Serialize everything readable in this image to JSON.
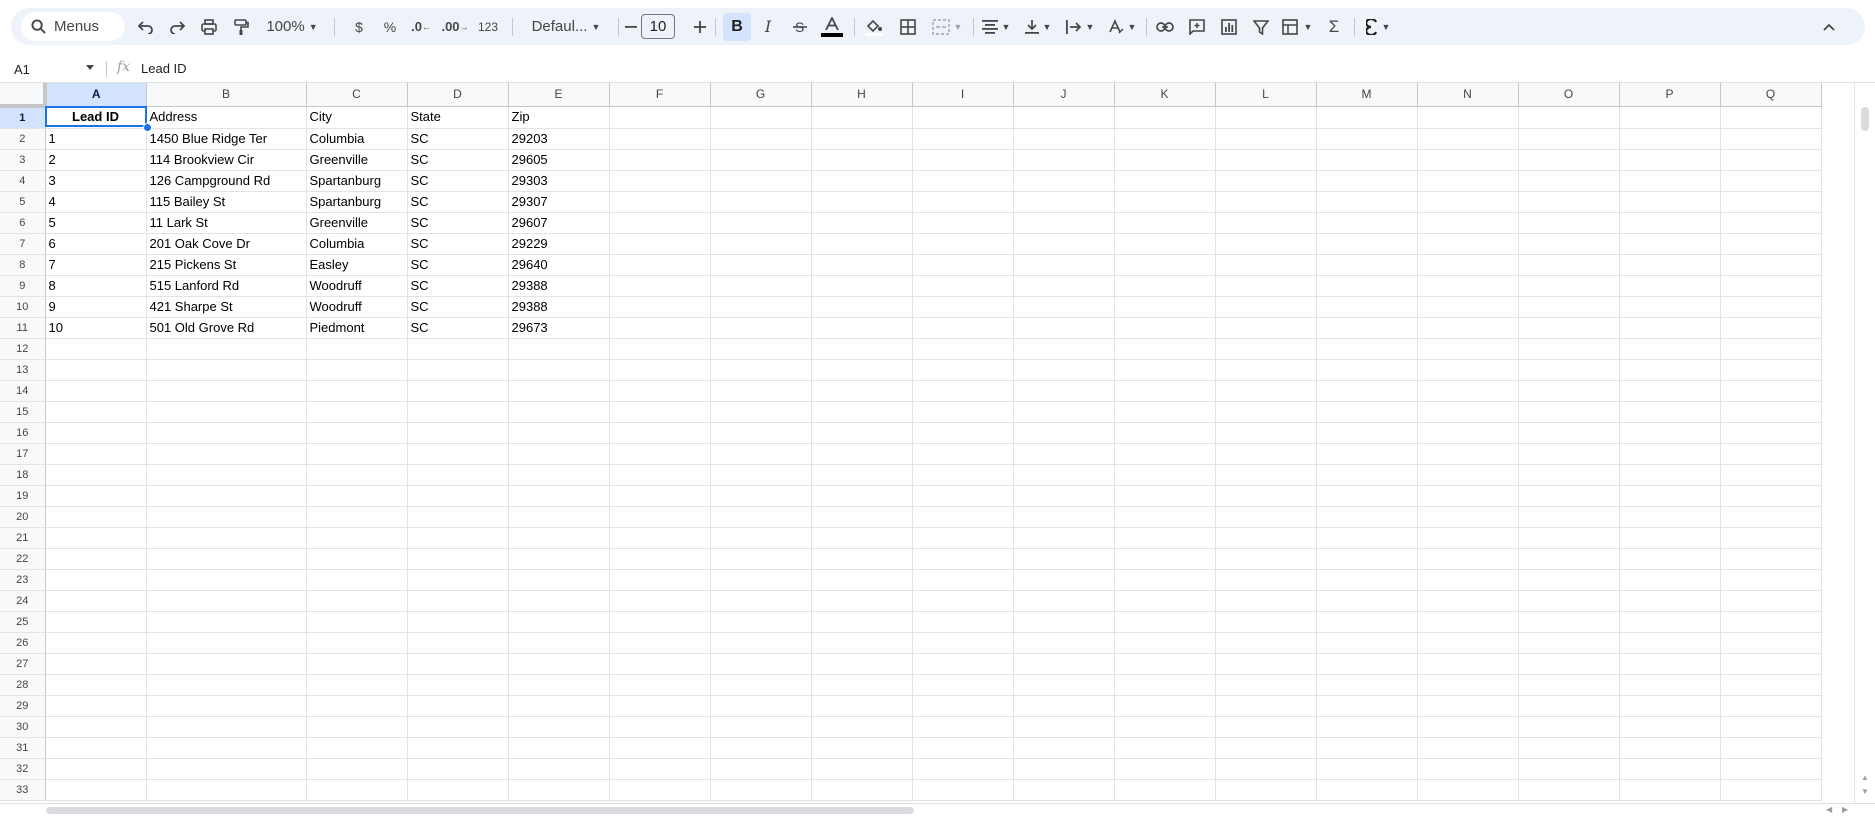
{
  "toolbar": {
    "menus_label": "Menus",
    "zoom": "100%",
    "currency": "$",
    "percent": "%",
    "dec_decrease": ".0",
    "dec_increase": ".00",
    "number_format": "123",
    "font_name": "Defaul...",
    "font_size": "10",
    "bold": "B",
    "italic": "I",
    "sigma": "Σ"
  },
  "formula_bar": {
    "cell_ref": "A1",
    "fx": "fx",
    "content": "Lead ID"
  },
  "sheet": {
    "columns": [
      "A",
      "B",
      "C",
      "D",
      "E",
      "F",
      "G",
      "H",
      "I",
      "J",
      "K",
      "L",
      "M",
      "N",
      "O",
      "P",
      "Q"
    ],
    "rows": [
      [
        "Lead ID",
        "Address",
        "City",
        "State",
        "Zip"
      ],
      [
        "1",
        "1450 Blue Ridge Ter",
        "Columbia",
        "SC",
        "29203"
      ],
      [
        "2",
        "114 Brookview Cir",
        "Greenville",
        "SC",
        "29605"
      ],
      [
        "3",
        "126 Campground Rd",
        "Spartanburg",
        "SC",
        "29303"
      ],
      [
        "4",
        "115 Bailey St",
        "Spartanburg",
        "SC",
        "29307"
      ],
      [
        "5",
        "11 Lark St",
        "Greenville",
        "SC",
        "29607"
      ],
      [
        "6",
        "201 Oak Cove Dr",
        "Columbia",
        "SC",
        "29229"
      ],
      [
        "7",
        "215 Pickens St",
        "Easley",
        "SC",
        "29640"
      ],
      [
        "8",
        "515 Lanford Rd",
        "Woodruff",
        "SC",
        "29388"
      ],
      [
        "9",
        "421 Sharpe St",
        "Woodruff",
        "SC",
        "29388"
      ],
      [
        "10",
        "501 Old Grove Rd",
        "Piedmont",
        "SC",
        "29673"
      ]
    ],
    "row_numbers": [
      "1",
      "2",
      "3",
      "4",
      "5",
      "6",
      "7",
      "8",
      "9",
      "10",
      "11",
      "12",
      "13",
      "14",
      "15",
      "16",
      "17",
      "18",
      "19",
      "20",
      "21",
      "22",
      "23",
      "24",
      "25",
      "26",
      "27",
      "28",
      "29",
      "30",
      "31",
      "32",
      "33"
    ]
  },
  "colors": {
    "toolbar_bg": "#eef2f9",
    "selection": "#1a73e8",
    "header_selected": "#d3e3fd"
  }
}
